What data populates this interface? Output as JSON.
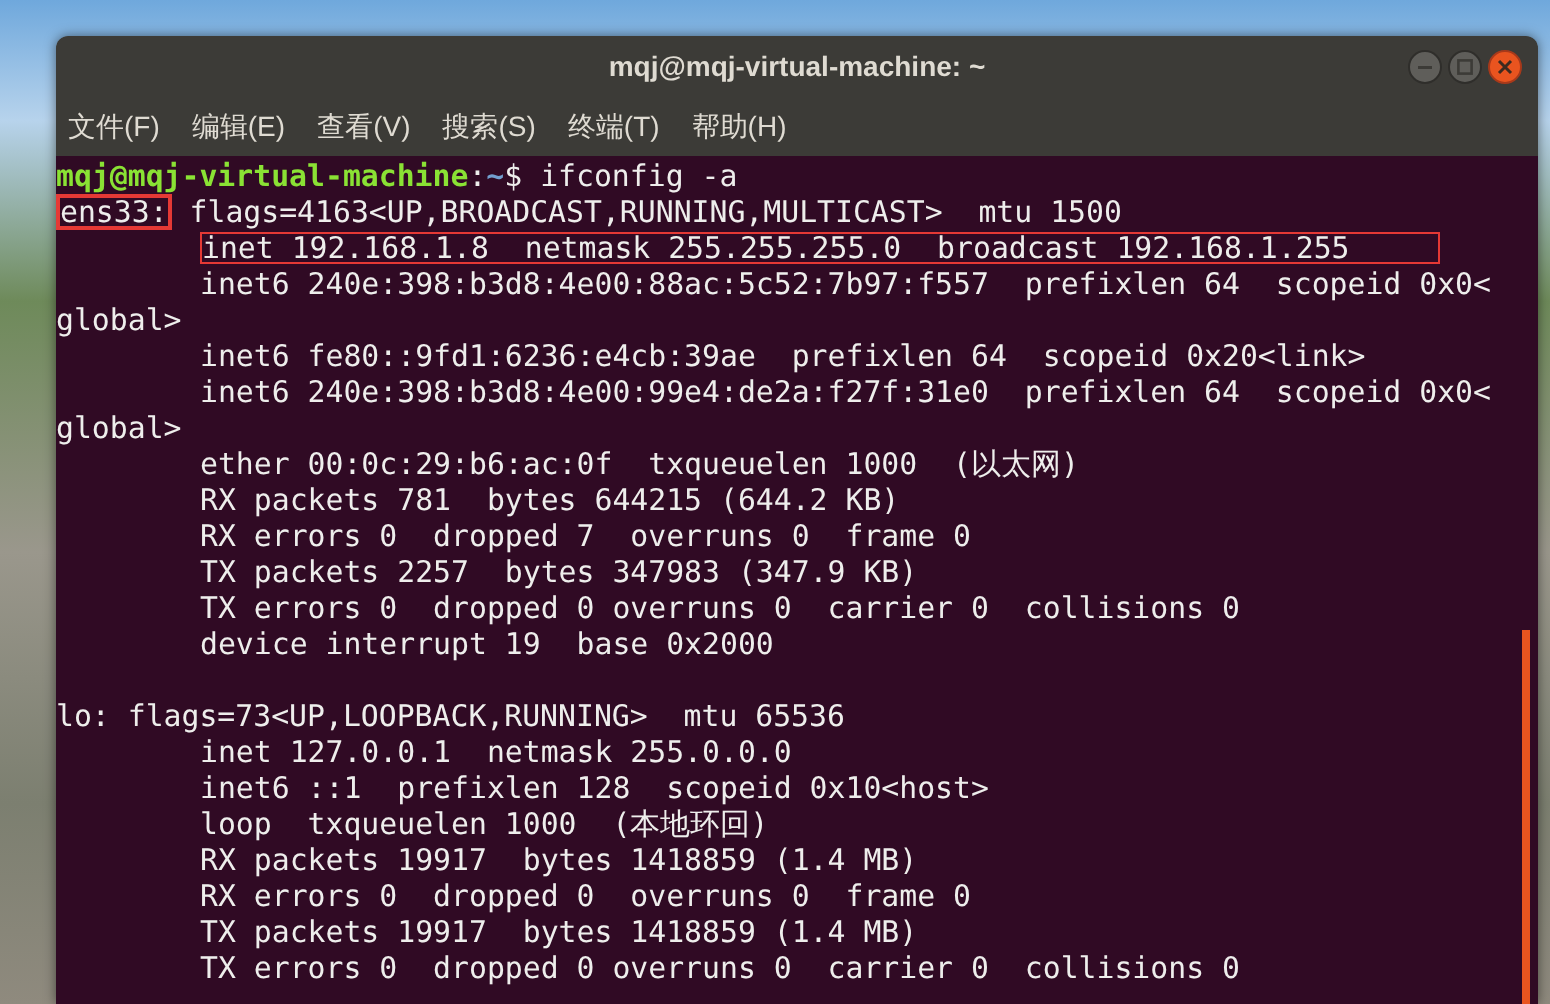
{
  "window": {
    "title": "mqj@mqj-virtual-machine: ~"
  },
  "menu": [
    "文件(F)",
    "编辑(E)",
    "查看(V)",
    "搜索(S)",
    "终端(T)",
    "帮助(H)"
  ],
  "terminal": {
    "lines": [
      {
        "indent": false,
        "segments": [
          {
            "kind": "user",
            "text": "mqj@mqj-virtual-machine"
          },
          {
            "kind": "text",
            "text": ":"
          },
          {
            "kind": "path",
            "text": "~"
          },
          {
            "kind": "text",
            "text": "$ ifconfig -a"
          }
        ]
      },
      {
        "indent": false,
        "segments": [
          {
            "kind": "text",
            "text": "ens33:",
            "highlighted": true,
            "heavy_frame": true
          },
          {
            "kind": "text",
            "text": " flags=4163<UP,BROADCAST,RUNNING,MULTICAST>  mtu 1500"
          }
        ]
      },
      {
        "indent": true,
        "segments": [
          {
            "kind": "text",
            "text": "inet 192.168.1.8  netmask 255.255.255.0  broadcast 192.168.1.255",
            "highlighted": true,
            "heavy_frame": false
          }
        ]
      },
      {
        "indent": true,
        "segments": [
          {
            "kind": "text",
            "text": "inet6 240e:398:b3d8:4e00:88ac:5c52:7b97:f557  prefixlen 64  scopeid 0x0<"
          }
        ]
      },
      {
        "indent": false,
        "segments": [
          {
            "kind": "text",
            "text": "global>"
          }
        ]
      },
      {
        "indent": true,
        "segments": [
          {
            "kind": "text",
            "text": "inet6 fe80::9fd1:6236:e4cb:39ae  prefixlen 64  scopeid 0x20<link>"
          }
        ]
      },
      {
        "indent": true,
        "segments": [
          {
            "kind": "text",
            "text": "inet6 240e:398:b3d8:4e00:99e4:de2a:f27f:31e0  prefixlen 64  scopeid 0x0<"
          }
        ]
      },
      {
        "indent": false,
        "segments": [
          {
            "kind": "text",
            "text": "global>"
          }
        ]
      },
      {
        "indent": true,
        "segments": [
          {
            "kind": "text",
            "text": "ether 00:0c:29:b6:ac:0f  txqueuelen 1000  (以太网)"
          }
        ]
      },
      {
        "indent": true,
        "segments": [
          {
            "kind": "text",
            "text": "RX packets 781  bytes 644215 (644.2 KB)"
          }
        ]
      },
      {
        "indent": true,
        "segments": [
          {
            "kind": "text",
            "text": "RX errors 0  dropped 7  overruns 0  frame 0"
          }
        ]
      },
      {
        "indent": true,
        "segments": [
          {
            "kind": "text",
            "text": "TX packets 2257  bytes 347983 (347.9 KB)"
          }
        ]
      },
      {
        "indent": true,
        "segments": [
          {
            "kind": "text",
            "text": "TX errors 0  dropped 0 overruns 0  carrier 0  collisions 0"
          }
        ]
      },
      {
        "indent": true,
        "segments": [
          {
            "kind": "text",
            "text": "device interrupt 19  base 0x2000"
          }
        ]
      },
      {
        "blank": true
      },
      {
        "indent": false,
        "segments": [
          {
            "kind": "text",
            "text": "lo: flags=73<UP,LOOPBACK,RUNNING>  mtu 65536"
          }
        ]
      },
      {
        "indent": true,
        "segments": [
          {
            "kind": "text",
            "text": "inet 127.0.0.1  netmask 255.0.0.0"
          }
        ]
      },
      {
        "indent": true,
        "segments": [
          {
            "kind": "text",
            "text": "inet6 ::1  prefixlen 128  scopeid 0x10<host>"
          }
        ]
      },
      {
        "indent": true,
        "segments": [
          {
            "kind": "text",
            "text": "loop  txqueuelen 1000  (本地环回)"
          }
        ]
      },
      {
        "indent": true,
        "segments": [
          {
            "kind": "text",
            "text": "RX packets 19917  bytes 1418859 (1.4 MB)"
          }
        ]
      },
      {
        "indent": true,
        "segments": [
          {
            "kind": "text",
            "text": "RX errors 0  dropped 0  overruns 0  frame 0"
          }
        ]
      },
      {
        "indent": true,
        "segments": [
          {
            "kind": "text",
            "text": "TX packets 19917  bytes 1418859 (1.4 MB)"
          }
        ]
      },
      {
        "indent": true,
        "segments": [
          {
            "kind": "text",
            "text": "TX errors 0  dropped 0 overruns 0  carrier 0  collisions 0"
          }
        ]
      }
    ]
  }
}
